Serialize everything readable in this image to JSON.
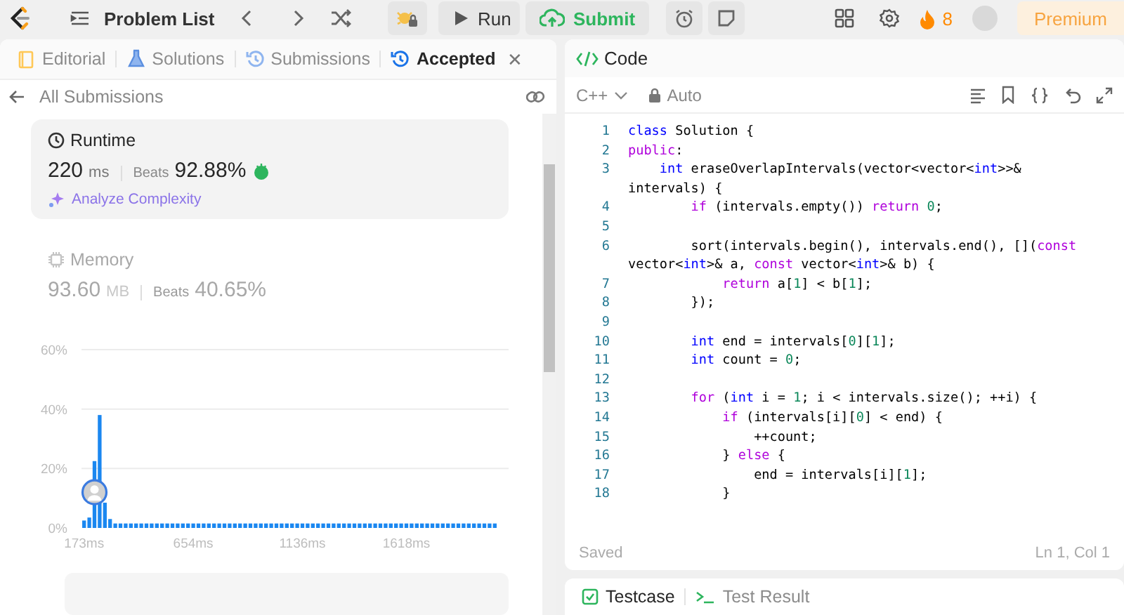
{
  "top_bar": {
    "problem_list": "Problem List",
    "run": "Run",
    "submit": "Submit",
    "streak": "8",
    "premium": "Premium"
  },
  "left_panel": {
    "tabs": [
      {
        "label": "Editorial",
        "kind": "book",
        "selected": false
      },
      {
        "label": "Solutions",
        "kind": "flask",
        "selected": false
      },
      {
        "label": "Submissions",
        "kind": "history",
        "selected": false
      },
      {
        "label": "Accepted",
        "kind": "history",
        "selected": true,
        "close": "✕"
      }
    ],
    "back_link": "All Submissions",
    "stats": [
      {
        "kind": "clock",
        "label": "Runtime",
        "value": "220",
        "unit": "ms",
        "beats_label": "Beats",
        "beats": "92.88%",
        "selected": true,
        "celebrate": true,
        "action": "Analyze Complexity"
      },
      {
        "kind": "chip",
        "label": "Memory",
        "value": "93.60",
        "unit": "MB",
        "beats_label": "Beats",
        "beats": "40.65%",
        "selected": false,
        "celebrate": false
      }
    ],
    "chart_data": {
      "type": "bar",
      "ylim": [
        0,
        60
      ],
      "yticks": [
        {
          "value": 0,
          "label": "0%"
        },
        {
          "value": 20,
          "label": "20%"
        },
        {
          "value": 40,
          "label": "40%"
        },
        {
          "value": 60,
          "label": "60%"
        }
      ],
      "categories": [
        "173ms",
        null,
        null,
        null,
        null,
        null,
        null,
        null,
        null,
        null,
        null,
        null,
        null,
        null,
        null,
        null,
        null,
        null,
        null,
        null,
        null,
        "654ms",
        null,
        null,
        null,
        null,
        null,
        null,
        null,
        null,
        null,
        null,
        null,
        null,
        null,
        null,
        null,
        null,
        null,
        null,
        null,
        null,
        "1136ms",
        null,
        null,
        null,
        null,
        null,
        null,
        null,
        null,
        null,
        null,
        null,
        null,
        null,
        null,
        null,
        null,
        null,
        null,
        null,
        "1618ms",
        null,
        null,
        null,
        null,
        null,
        null,
        null,
        null,
        null,
        null,
        null,
        null,
        null,
        null,
        null,
        null,
        null
      ],
      "values": [
        2.5,
        3.5,
        22.5,
        38,
        8.5,
        3,
        1.5,
        1.5,
        1.5,
        1.5,
        1.5,
        1.5,
        1.5,
        1.5,
        1.5,
        1.5,
        1.5,
        1.5,
        1.5,
        1.5,
        1.5,
        1.5,
        1.5,
        1.5,
        1.5,
        1.5,
        1.5,
        1.5,
        1.5,
        1.5,
        1.5,
        1.5,
        1.5,
        1.5,
        1.5,
        1.5,
        1.5,
        1.5,
        1.5,
        1.5,
        1.5,
        1.5,
        1.5,
        1.5,
        1.5,
        1.5,
        1.5,
        1.5,
        1.5,
        1.5,
        1.5,
        1.5,
        1.5,
        1.5,
        1.5,
        1.5,
        1.5,
        1.5,
        1.5,
        1.5,
        1.5,
        1.5,
        1.5,
        1.5,
        1.5,
        1.5,
        1.5,
        1.5,
        1.5,
        1.5,
        1.5,
        1.5,
        1.5,
        1.5,
        1.5,
        1.5,
        1.5,
        1.5,
        1.5,
        1.5
      ]
    }
  },
  "code_panel": {
    "title": "Code",
    "language": "C++",
    "mode": "Auto",
    "lines": [
      {
        "number": "1",
        "text": "class Solution {"
      },
      {
        "number": "2",
        "text": "public:"
      },
      {
        "number": "3",
        "text": "    int eraseOverlapIntervals(vector<vector<int>>& intervals) {"
      },
      {
        "number": "4",
        "text": "        if (intervals.empty()) return 0;"
      },
      {
        "number": "5"
      },
      {
        "number": "6",
        "text": "        sort(intervals.begin(), intervals.end(), [](const vector<int>& a, const vector<int>& b) {"
      },
      {
        "number": "7",
        "text": "            return a[1] < b[1];"
      },
      {
        "number": "8",
        "text": "        });"
      },
      {
        "number": "9"
      },
      {
        "number": "10",
        "text": "        int end = intervals[0][1];"
      },
      {
        "number": "11",
        "text": "        int count = 0;"
      },
      {
        "number": "12"
      },
      {
        "number": "13",
        "text": "        for (int i = 1; i < intervals.size(); ++i) {"
      },
      {
        "number": "14",
        "text": "            if (intervals[i][0] < end) {"
      },
      {
        "number": "15",
        "text": "                ++count;"
      },
      {
        "number": "16",
        "text": "            } else {"
      },
      {
        "number": "17",
        "text": "                end = intervals[i][1];"
      },
      {
        "number": "18",
        "text": "            }"
      }
    ],
    "status": "Saved",
    "cursor": "Ln 1, Col 1"
  },
  "bottom_panel": {
    "tabs": [
      {
        "label": "Testcase",
        "kind": "check",
        "selected": true
      },
      {
        "label": "Test Result",
        "kind": "terminal",
        "selected": false
      }
    ]
  }
}
